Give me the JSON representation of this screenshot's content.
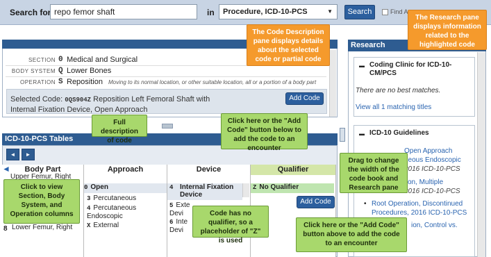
{
  "search": {
    "label": "Search for",
    "value": "repo femor shaft",
    "in_label": "in",
    "scope": "Procedure, ICD-10-PCS",
    "button": "Search",
    "find_all_label": "Find A"
  },
  "description": {
    "rows": [
      {
        "label": "SECTION",
        "char": "0",
        "value": "Medical and Surgical",
        "note": ""
      },
      {
        "label": "BODY SYSTEM",
        "char": "Q",
        "value": "Lower Bones",
        "note": ""
      },
      {
        "label": "OPERATION",
        "char": "S",
        "value": "Reposition",
        "note": "Moving to its normal location, or other suitable location, all or a portion of a body part"
      }
    ],
    "selected_prefix": "Selected Code:",
    "selected_code": "0QS904Z",
    "selected_desc": "Reposition Left Femoral Shaft with Internal Fixation Device, Open Approach",
    "add_code": "Add Code"
  },
  "tables": {
    "title": "ICD-10-PCS Tables",
    "prev": "◄",
    "next": "►",
    "columns": [
      "Body Part",
      "Approach",
      "Device",
      "Qualifier"
    ],
    "body_part": [
      "Upper Femur, Right",
      "Lower Femur, Right"
    ],
    "approach": [
      {
        "char": "0",
        "label": "Open"
      },
      {
        "char": "3",
        "label": "Percutaneous"
      },
      {
        "char": "4",
        "label": "Percutaneous Endoscopic"
      },
      {
        "char": "X",
        "label": "External"
      }
    ],
    "device": [
      {
        "char": "4",
        "label": "Internal Fixation Device"
      },
      {
        "char": "5",
        "label": "Exte Devi"
      },
      {
        "char": "6",
        "label": "Inte Devi"
      }
    ],
    "qualifier": {
      "char": "Z",
      "label": "No Qualifier"
    },
    "add_code": "Add Code",
    "row_char_8": "8"
  },
  "research": {
    "title": "Research",
    "coding_clinic": {
      "title": "Coding Clinic for ICD-10-CM/PCS",
      "no_match": "There are no best matches.",
      "link": "View all 1 matching titles"
    },
    "guidelines": {
      "title": "ICD-10 Guidelines",
      "items": [
        "Open Approach",
        "neous Endoscopic",
        "2016 ICD-10-PCS",
        "tion, Multiple",
        "2016 ICD-10-PCS",
        "Root Operation, Discontinued",
        "Procedures, 2016 ICD-10-PCS",
        "ion, Control vs."
      ]
    }
  },
  "callouts": {
    "desc_pane": "The Code Description pane displays details about the selected code or partial code",
    "research_pane": "The Research pane displays information related to the highlighted code",
    "full_desc": "Full description of code",
    "add_below": "Click here or the \"Add Code\" button below to add the code to an encounter",
    "drag": "Drag to change the width of the code book and Research pane",
    "view_cols": "Click to view Section, Body System, and Operation columns",
    "no_qualifier": "Code has no qualifier, so a placeholder of \"Z\" is used",
    "add_above": "Click here or the \"Add Code\" button above to add the code to an encounter"
  },
  "colors": {
    "accent": "#2e5c91",
    "orange": "#f59a2c",
    "green": "#a8d86c"
  }
}
